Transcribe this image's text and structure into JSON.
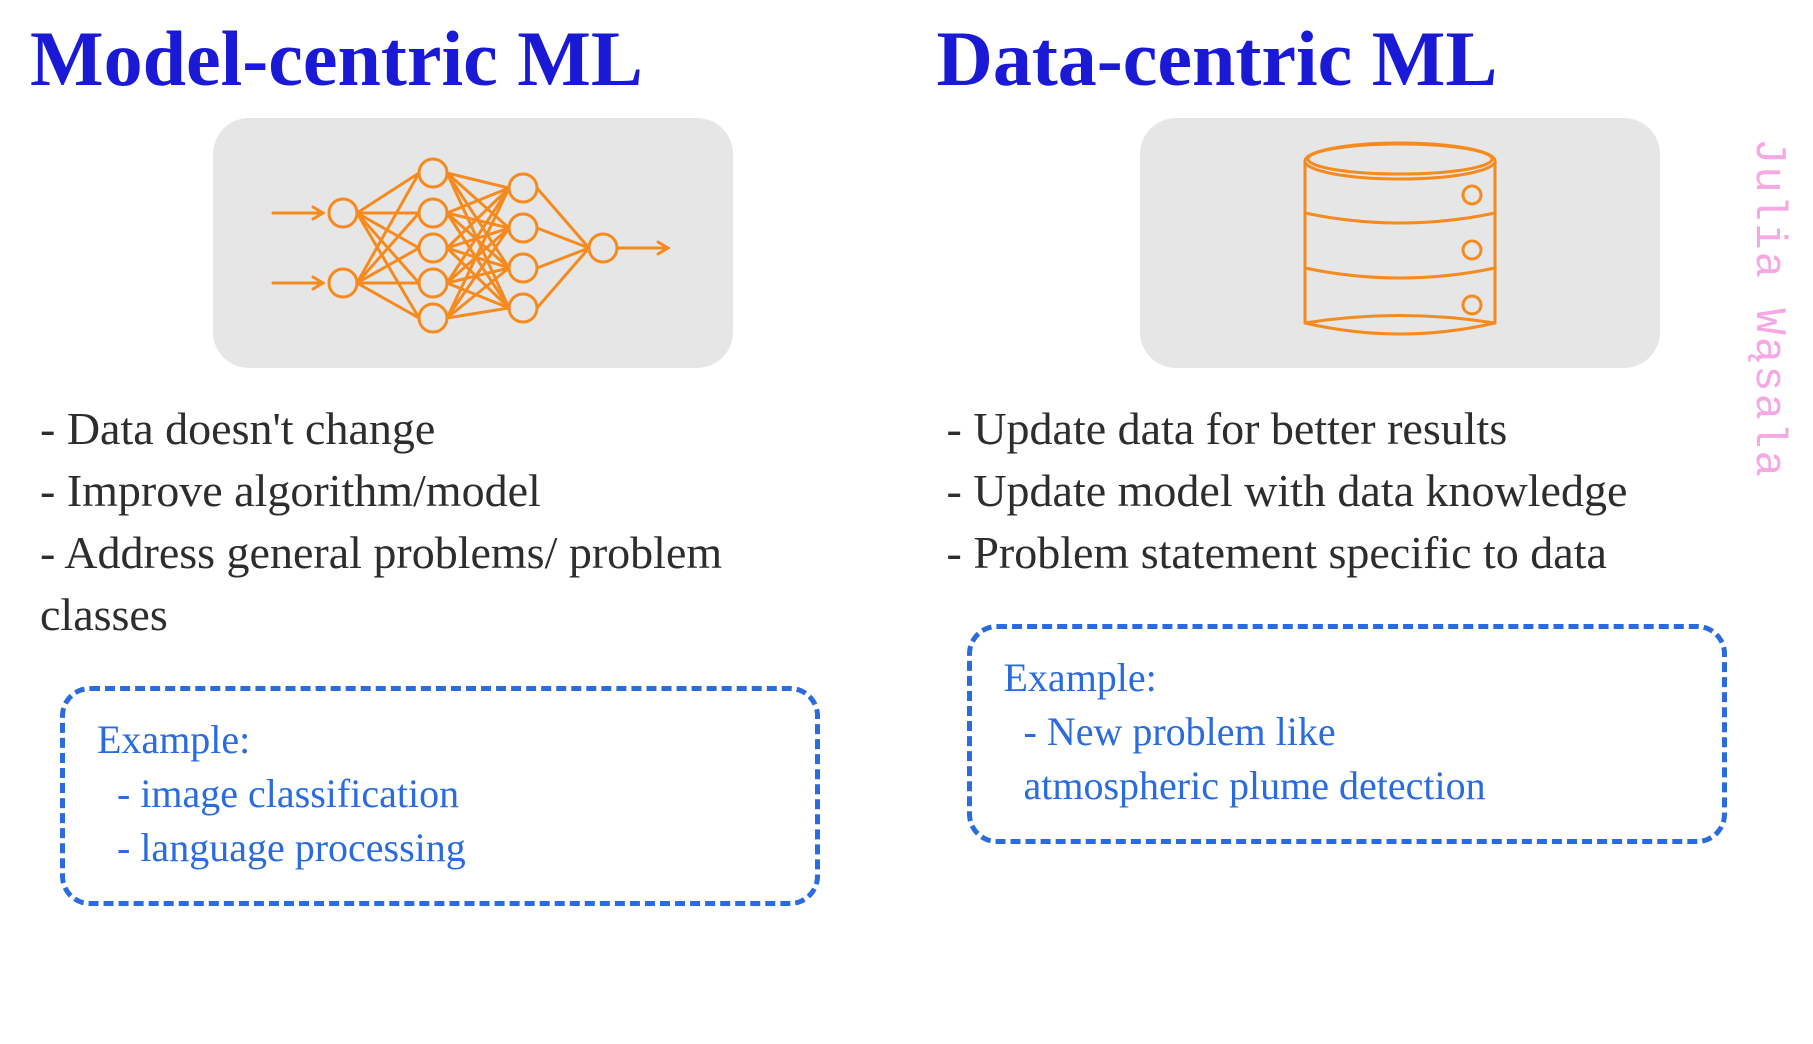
{
  "author": "Julia Wąsala",
  "columns": {
    "left": {
      "title": "Model-centric ML",
      "icon_name": "neural-network-icon",
      "bullets": [
        "- Data doesn't change",
        "- Improve algorithm/model",
        "- Address general problems/ problem classes"
      ],
      "example": {
        "label": "Example:",
        "items": [
          "- image classification",
          "- language processing"
        ]
      }
    },
    "right": {
      "title": "Data-centric ML",
      "icon_name": "database-icon",
      "bullets": [
        "- Update data for better results",
        "- Update model with data knowledge",
        "- Problem statement specific to data"
      ],
      "example": {
        "label": "Example:",
        "items": [
          "- New problem like",
          "  atmospheric plume detection"
        ]
      }
    }
  },
  "colors": {
    "title": "#1a1ad6",
    "accent": "#2a6be0",
    "sketch": "#f58a1f",
    "author": "#f5a8e4",
    "panel": "#e6e6e6"
  }
}
